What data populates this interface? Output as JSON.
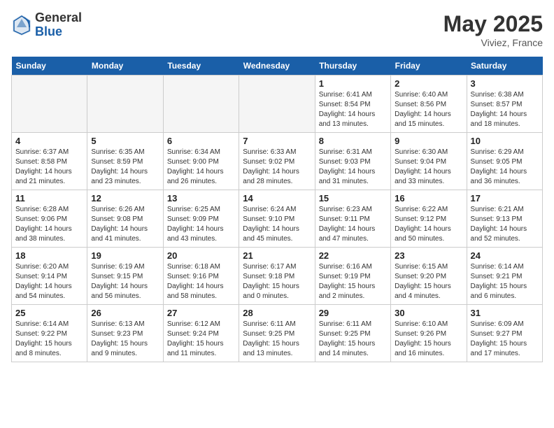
{
  "header": {
    "logo_general": "General",
    "logo_blue": "Blue",
    "month_year": "May 2025",
    "location": "Viviez, France"
  },
  "days_of_week": [
    "Sunday",
    "Monday",
    "Tuesday",
    "Wednesday",
    "Thursday",
    "Friday",
    "Saturday"
  ],
  "weeks": [
    [
      {
        "day": "",
        "empty": true
      },
      {
        "day": "",
        "empty": true
      },
      {
        "day": "",
        "empty": true
      },
      {
        "day": "",
        "empty": true
      },
      {
        "day": "1",
        "sunrise": "Sunrise: 6:41 AM",
        "sunset": "Sunset: 8:54 PM",
        "daylight": "Daylight: 14 hours and 13 minutes."
      },
      {
        "day": "2",
        "sunrise": "Sunrise: 6:40 AM",
        "sunset": "Sunset: 8:56 PM",
        "daylight": "Daylight: 14 hours and 15 minutes."
      },
      {
        "day": "3",
        "sunrise": "Sunrise: 6:38 AM",
        "sunset": "Sunset: 8:57 PM",
        "daylight": "Daylight: 14 hours and 18 minutes."
      }
    ],
    [
      {
        "day": "4",
        "sunrise": "Sunrise: 6:37 AM",
        "sunset": "Sunset: 8:58 PM",
        "daylight": "Daylight: 14 hours and 21 minutes."
      },
      {
        "day": "5",
        "sunrise": "Sunrise: 6:35 AM",
        "sunset": "Sunset: 8:59 PM",
        "daylight": "Daylight: 14 hours and 23 minutes."
      },
      {
        "day": "6",
        "sunrise": "Sunrise: 6:34 AM",
        "sunset": "Sunset: 9:00 PM",
        "daylight": "Daylight: 14 hours and 26 minutes."
      },
      {
        "day": "7",
        "sunrise": "Sunrise: 6:33 AM",
        "sunset": "Sunset: 9:02 PM",
        "daylight": "Daylight: 14 hours and 28 minutes."
      },
      {
        "day": "8",
        "sunrise": "Sunrise: 6:31 AM",
        "sunset": "Sunset: 9:03 PM",
        "daylight": "Daylight: 14 hours and 31 minutes."
      },
      {
        "day": "9",
        "sunrise": "Sunrise: 6:30 AM",
        "sunset": "Sunset: 9:04 PM",
        "daylight": "Daylight: 14 hours and 33 minutes."
      },
      {
        "day": "10",
        "sunrise": "Sunrise: 6:29 AM",
        "sunset": "Sunset: 9:05 PM",
        "daylight": "Daylight: 14 hours and 36 minutes."
      }
    ],
    [
      {
        "day": "11",
        "sunrise": "Sunrise: 6:28 AM",
        "sunset": "Sunset: 9:06 PM",
        "daylight": "Daylight: 14 hours and 38 minutes."
      },
      {
        "day": "12",
        "sunrise": "Sunrise: 6:26 AM",
        "sunset": "Sunset: 9:08 PM",
        "daylight": "Daylight: 14 hours and 41 minutes."
      },
      {
        "day": "13",
        "sunrise": "Sunrise: 6:25 AM",
        "sunset": "Sunset: 9:09 PM",
        "daylight": "Daylight: 14 hours and 43 minutes."
      },
      {
        "day": "14",
        "sunrise": "Sunrise: 6:24 AM",
        "sunset": "Sunset: 9:10 PM",
        "daylight": "Daylight: 14 hours and 45 minutes."
      },
      {
        "day": "15",
        "sunrise": "Sunrise: 6:23 AM",
        "sunset": "Sunset: 9:11 PM",
        "daylight": "Daylight: 14 hours and 47 minutes."
      },
      {
        "day": "16",
        "sunrise": "Sunrise: 6:22 AM",
        "sunset": "Sunset: 9:12 PM",
        "daylight": "Daylight: 14 hours and 50 minutes."
      },
      {
        "day": "17",
        "sunrise": "Sunrise: 6:21 AM",
        "sunset": "Sunset: 9:13 PM",
        "daylight": "Daylight: 14 hours and 52 minutes."
      }
    ],
    [
      {
        "day": "18",
        "sunrise": "Sunrise: 6:20 AM",
        "sunset": "Sunset: 9:14 PM",
        "daylight": "Daylight: 14 hours and 54 minutes."
      },
      {
        "day": "19",
        "sunrise": "Sunrise: 6:19 AM",
        "sunset": "Sunset: 9:15 PM",
        "daylight": "Daylight: 14 hours and 56 minutes."
      },
      {
        "day": "20",
        "sunrise": "Sunrise: 6:18 AM",
        "sunset": "Sunset: 9:16 PM",
        "daylight": "Daylight: 14 hours and 58 minutes."
      },
      {
        "day": "21",
        "sunrise": "Sunrise: 6:17 AM",
        "sunset": "Sunset: 9:18 PM",
        "daylight": "Daylight: 15 hours and 0 minutes."
      },
      {
        "day": "22",
        "sunrise": "Sunrise: 6:16 AM",
        "sunset": "Sunset: 9:19 PM",
        "daylight": "Daylight: 15 hours and 2 minutes."
      },
      {
        "day": "23",
        "sunrise": "Sunrise: 6:15 AM",
        "sunset": "Sunset: 9:20 PM",
        "daylight": "Daylight: 15 hours and 4 minutes."
      },
      {
        "day": "24",
        "sunrise": "Sunrise: 6:14 AM",
        "sunset": "Sunset: 9:21 PM",
        "daylight": "Daylight: 15 hours and 6 minutes."
      }
    ],
    [
      {
        "day": "25",
        "sunrise": "Sunrise: 6:14 AM",
        "sunset": "Sunset: 9:22 PM",
        "daylight": "Daylight: 15 hours and 8 minutes."
      },
      {
        "day": "26",
        "sunrise": "Sunrise: 6:13 AM",
        "sunset": "Sunset: 9:23 PM",
        "daylight": "Daylight: 15 hours and 9 minutes."
      },
      {
        "day": "27",
        "sunrise": "Sunrise: 6:12 AM",
        "sunset": "Sunset: 9:24 PM",
        "daylight": "Daylight: 15 hours and 11 minutes."
      },
      {
        "day": "28",
        "sunrise": "Sunrise: 6:11 AM",
        "sunset": "Sunset: 9:25 PM",
        "daylight": "Daylight: 15 hours and 13 minutes."
      },
      {
        "day": "29",
        "sunrise": "Sunrise: 6:11 AM",
        "sunset": "Sunset: 9:25 PM",
        "daylight": "Daylight: 15 hours and 14 minutes."
      },
      {
        "day": "30",
        "sunrise": "Sunrise: 6:10 AM",
        "sunset": "Sunset: 9:26 PM",
        "daylight": "Daylight: 15 hours and 16 minutes."
      },
      {
        "day": "31",
        "sunrise": "Sunrise: 6:09 AM",
        "sunset": "Sunset: 9:27 PM",
        "daylight": "Daylight: 15 hours and 17 minutes."
      }
    ]
  ]
}
